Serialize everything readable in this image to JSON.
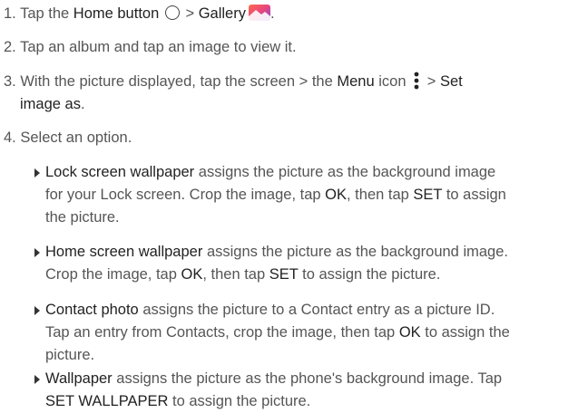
{
  "steps": {
    "s1": {
      "num": "1.",
      "t1": "Tap the",
      "home_button": "Home button",
      "sep": ">",
      "gallery": "Gallery",
      "end": "."
    },
    "s2": {
      "num": "2.",
      "text": "Tap an album and tap an image to view it."
    },
    "s3": {
      "num": "3.",
      "t1": "With the picture displayed, tap the screen > the",
      "menu": "Menu",
      "t2": "icon",
      "sep": ">",
      "set_line1": "Set",
      "set_line2": "image as",
      "end": "."
    },
    "s4": {
      "num": "4.",
      "text": "Select an option."
    }
  },
  "options": [
    {
      "title": "Lock screen wallpaper",
      "l1": "assigns the picture as the background image",
      "l2a": "for your Lock screen. Crop the image, tap",
      "ok": "OK",
      "l2b": ", then tap",
      "set": "SET",
      "l2c": "to assign",
      "l3": "the picture."
    },
    {
      "title": "Home screen wallpaper",
      "l1": "assigns the picture as the background image.",
      "l2a": "Crop the image, tap",
      "ok": "OK",
      "l2b": ", then tap",
      "set": "SET",
      "l2c": "to assign the picture."
    },
    {
      "title": "Contact photo",
      "l1": "assigns the picture to a Contact entry as a picture ID.",
      "l2a": "Tap an entry from Contacts, crop the image, then tap",
      "ok": "OK",
      "l2b": "to assign the",
      "l3": "picture."
    },
    {
      "title": "Wallpaper",
      "l1": "assigns the picture as the phone's background image. Tap",
      "setwall": "SET WALLPAPER",
      "l2b": "to assign the picture."
    }
  ],
  "icons": {
    "home": "home-circle-icon",
    "gallery": "gallery-icon",
    "menu": "menu-dots-icon"
  }
}
